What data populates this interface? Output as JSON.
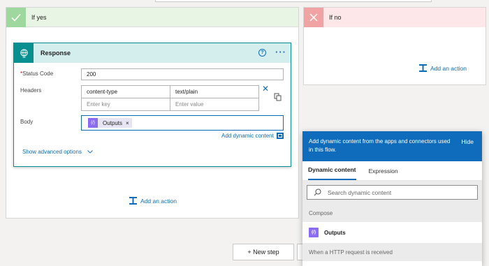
{
  "yes_branch": {
    "title": "If yes",
    "add_action_label": "Add an action"
  },
  "no_branch": {
    "title": "If no",
    "add_action_label": "Add an action"
  },
  "response_card": {
    "title": "Response",
    "status_code_label": "Status Code",
    "status_code_value": "200",
    "headers_label": "Headers",
    "headers": [
      {
        "key": "content-type",
        "value": "text/plain"
      }
    ],
    "header_key_placeholder": "Enter key",
    "header_value_placeholder": "Enter value",
    "body_label": "Body",
    "body_token": "Outputs",
    "add_dynamic_content": "Add dynamic content",
    "show_advanced_options": "Show advanced options"
  },
  "new_step_label": "+ New step",
  "dynamic_flyout": {
    "description": "Add dynamic content from the apps and connectors used in this flow.",
    "hide_label": "Hide",
    "tabs": [
      "Dynamic content",
      "Expression"
    ],
    "active_tab": "Dynamic content",
    "search_placeholder": "Search dynamic content",
    "sections": [
      {
        "title": "Compose",
        "items": [
          "Outputs"
        ]
      },
      {
        "title": "When a HTTP request is received",
        "items": []
      }
    ]
  },
  "colors": {
    "accent": "#0f6cbd",
    "response_teal": "#088f8f",
    "compose_purple": "#8c6cf2",
    "yes_green": "#9fd89f",
    "no_red": "#f1a3a3"
  }
}
